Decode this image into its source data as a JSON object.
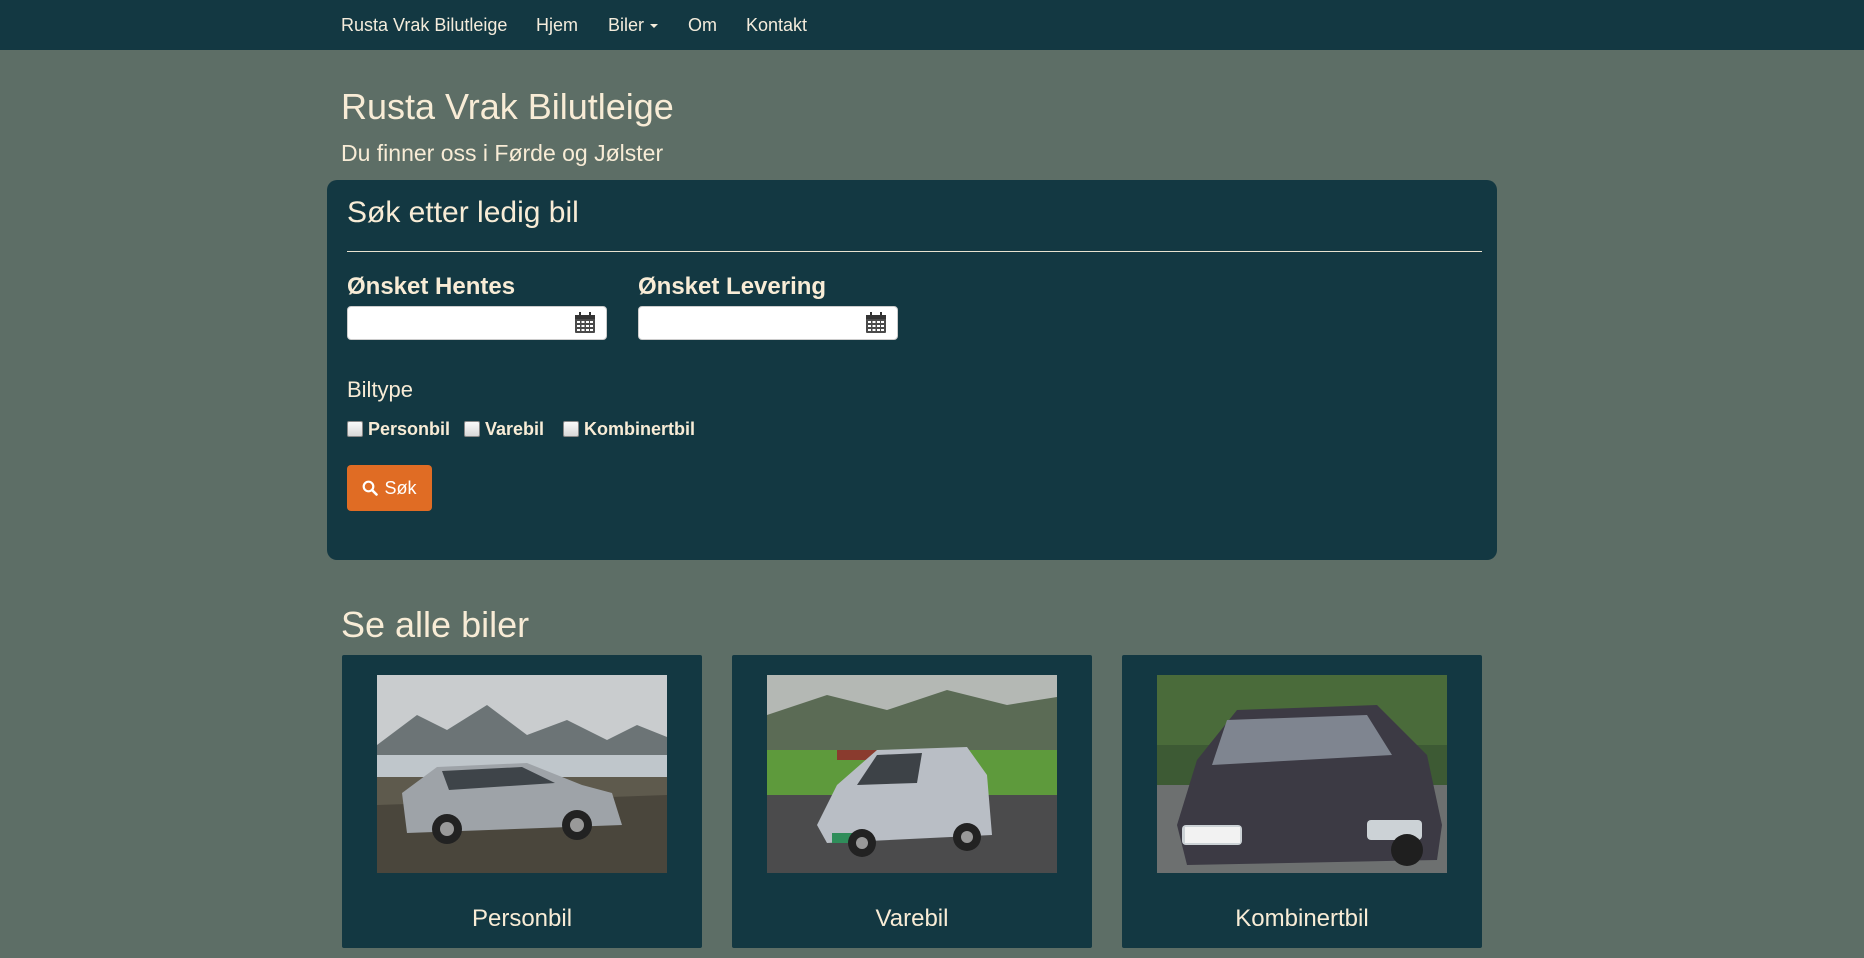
{
  "nav": {
    "brand": "Rusta Vrak Bilutleige",
    "items": [
      {
        "label": "Hjem"
      },
      {
        "label": "Biler"
      },
      {
        "label": "Om"
      },
      {
        "label": "Kontakt"
      }
    ]
  },
  "header": {
    "title": "Rusta Vrak Bilutleige",
    "subtitle": "Du finner oss i Førde og Jølster"
  },
  "search": {
    "title": "Søk etter ledig bil",
    "pickup_label": "Ønsket Hentes",
    "pickup_value": "",
    "return_label": "Ønsket Levering",
    "return_value": "",
    "cartype_label": "Biltype",
    "checkboxes": [
      {
        "label": "Personbil",
        "checked": false
      },
      {
        "label": "Varebil",
        "checked": false
      },
      {
        "label": "Kombinertbil",
        "checked": false
      }
    ],
    "button_label": "Søk",
    "button_color": "#e06c24"
  },
  "cars": {
    "title": "Se alle biler",
    "items": [
      {
        "label": "Personbil"
      },
      {
        "label": "Varebil"
      },
      {
        "label": "Kombinertbil"
      }
    ]
  },
  "colors": {
    "background": "#5d6e66",
    "panel": "#133842",
    "text": "#f8ecd6",
    "accent": "#e06c24"
  },
  "icons": [
    "calendar-icon",
    "search-icon",
    "caret-down-icon"
  ]
}
